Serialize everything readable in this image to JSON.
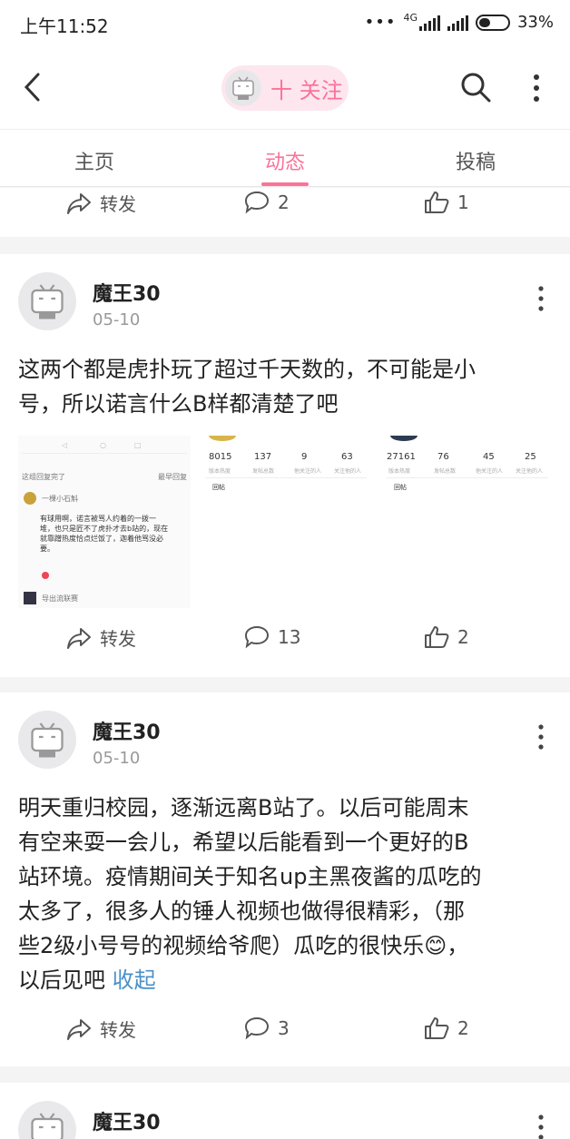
{
  "status_bar": {
    "time": "上午11:52",
    "network": "4G",
    "battery": "33%"
  },
  "header": {
    "follow_label": "十 关注"
  },
  "tabs": [
    {
      "label": "主页"
    },
    {
      "label": "动态"
    },
    {
      "label": "投稿"
    }
  ],
  "actions": {
    "repost_label": "转发"
  },
  "top_partial": {
    "comment_count": "2",
    "like_count": "1"
  },
  "posts": [
    {
      "username": "魔王30",
      "date": "05-10",
      "text_line1": "这两个都是虎扑玩了超过千天数的，不可能是小",
      "text_line2": "号，所以诺言什么B样都清楚了吧",
      "comment_count": "13",
      "like_count": "2",
      "thumb1": {
        "header": "这组回复完了",
        "sort": "最早回复",
        "user": "一棵小石斛",
        "body1": "有球用啊，诺言被骂人约着的一拨一",
        "body2": "堆，也只是匠不了虎扑才去b站的，现在",
        "body3": "就靠蹭热度恰点烂饭了，迦着他骂没必",
        "body4": "要。",
        "user2": "导出流联赛"
      },
      "thumb2": {
        "stats": [
          "8015",
          "137",
          "9",
          "63"
        ],
        "labels": [
          "版本热度",
          "发帖总数",
          "他关注的人",
          "关注他的人"
        ],
        "tab": "回帖"
      },
      "thumb3": {
        "stats": [
          "27161",
          "76",
          "45",
          "25"
        ],
        "labels": [
          "版本热度",
          "发帖总数",
          "他关注的人",
          "关注他的人"
        ],
        "tab": "回帖"
      }
    },
    {
      "username": "魔王30",
      "date": "05-10",
      "lines": [
        "明天重归校园，逐渐远离B站了。以后可能周末",
        "有空来耍一会儿，希望以后能看到一个更好的B",
        "站环境。疫情期间关于知名up主黑夜酱的瓜吃的",
        "太多了，很多人的锤人视频也做得很精彩，（那",
        "些2级小号号的视频给爷爬）瓜吃的很快乐😊，"
      ],
      "last_line": "以后见吧",
      "collapse_label": "收起",
      "comment_count": "3",
      "like_count": "2"
    },
    {
      "username": "魔王30"
    }
  ],
  "colors": {
    "accent": "#fb7299",
    "link": "#4a90c8"
  }
}
